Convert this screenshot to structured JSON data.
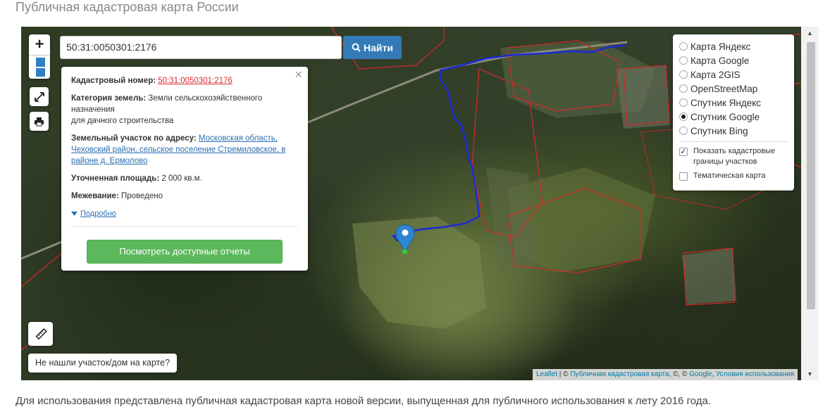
{
  "page": {
    "title": "Публичная кадастровая карта России",
    "footer_text": "Для использования представлена публичная кадастровая карта новой версии, выпущенная для публичного использования к лету 2016 года."
  },
  "map": {
    "search_value": "50:31:0050301:2176",
    "find_button": "Найти",
    "zoom_in": "+",
    "missing_button": "Не нашли участок/дом на карте?",
    "icons": [
      "search-icon",
      "fullscreen-icon",
      "print-icon",
      "ruler-icon",
      "location-marker-icon",
      "close-icon"
    ]
  },
  "popup": {
    "close": "×",
    "cadastral_label": "Кадастровый номер:",
    "cadastral_value": "50:31:0050301:2176",
    "category_label": "Категория земель:",
    "category_value": "Земли сельскохозяйственного назначения",
    "category_value2": "для дачного строительства",
    "address_label": "Земельный участок по адресу:",
    "address_value": "Московская область, Чеховский район, сельское поселение Стремиловское, в районе д. Ермолово",
    "area_label": "Уточненная площадь:",
    "area_value": "2 000 кв.м.",
    "survey_label": "Межевание:",
    "survey_value": "Проведено",
    "more_link": "Подробно",
    "reports_button": "Посмотреть доступные отчеты"
  },
  "layers": {
    "options": [
      {
        "label": "Карта Яндекс",
        "selected": false
      },
      {
        "label": "Карта Google",
        "selected": false
      },
      {
        "label": "Карта 2GIS",
        "selected": false
      },
      {
        "label": "OpenStreetMap",
        "selected": false
      },
      {
        "label": "Спутник Яндекс",
        "selected": false
      },
      {
        "label": "Спутник Google",
        "selected": true
      },
      {
        "label": "Спутник Bing",
        "selected": false
      }
    ],
    "checkboxes": [
      {
        "label": "Показать кадастровые границы участков",
        "checked": true
      },
      {
        "label": "Тематическая карта",
        "checked": false
      }
    ]
  },
  "attribution": {
    "leaflet": "Leaflet",
    "sep1": " | © ",
    "pkk": "Публичная кадастровая карта",
    "mid": ", ©, © ",
    "google": "Google",
    "sep2": ", ",
    "terms": "Условия использования"
  },
  "colors": {
    "route": "#1c2bd6",
    "parcel_border": "#d9262b",
    "find_button": "#337ab7",
    "reports_button": "#5cb85c",
    "marker": "#2f86d0"
  }
}
